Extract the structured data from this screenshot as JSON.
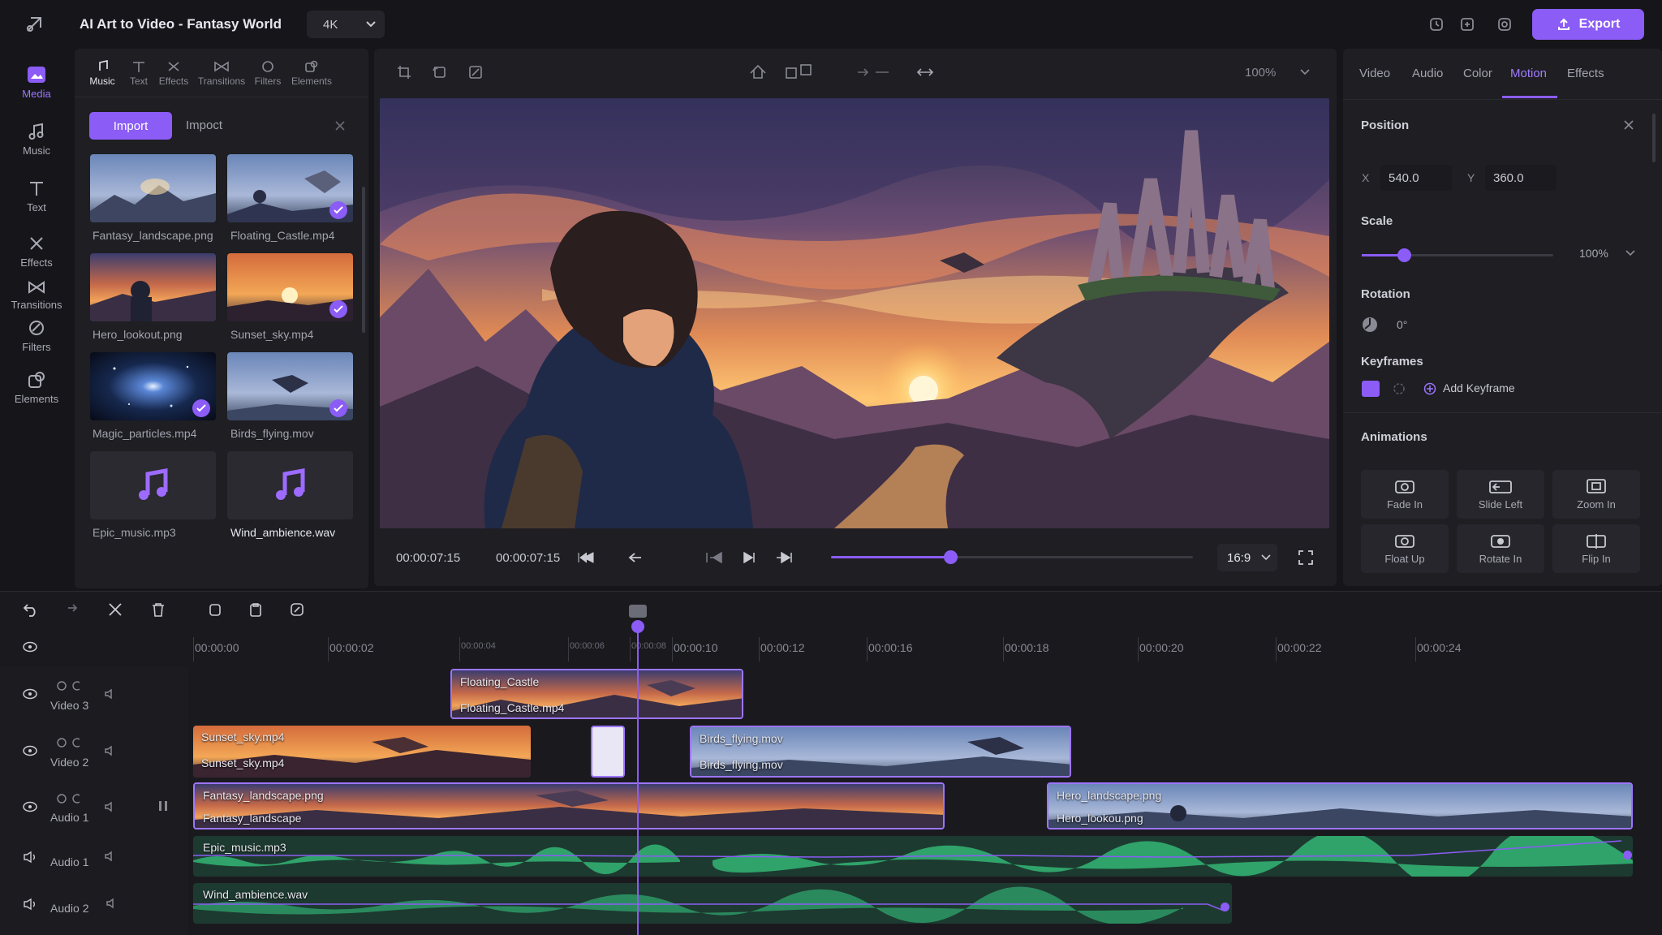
{
  "app": {
    "title": "AI Art to Video - Fantasy World",
    "resolution": "4K",
    "export_label": "Export",
    "accent": "#8b5cf6"
  },
  "rail": [
    {
      "label": "Media",
      "icon": "media-icon",
      "active": true
    },
    {
      "label": "Music",
      "icon": "music-icon"
    },
    {
      "label": "Text",
      "icon": "text-icon"
    },
    {
      "label": "Effects",
      "icon": "effects-icon"
    },
    {
      "label": "Transitions",
      "icon": "transitions-icon"
    },
    {
      "label": "Filters",
      "icon": "filters-icon"
    },
    {
      "label": "Elements",
      "icon": "elements-icon"
    }
  ],
  "media_panel": {
    "tabs": [
      "Music",
      "Text",
      "Effects",
      "Transitions",
      "Filters",
      "Elements"
    ],
    "import_label": "Import",
    "import_alt": "Impoct",
    "items": [
      {
        "name": "Fantasy_landscape.png",
        "checked": false
      },
      {
        "name": "Floating_Castle.mp4",
        "checked": true
      },
      {
        "name": "Hero_lookout.png",
        "checked": false
      },
      {
        "name": "Sunset_sky.mp4",
        "checked": true
      },
      {
        "name": "Magic_particles.mp4",
        "checked": true
      },
      {
        "name": "Birds_flying.mov",
        "checked": true
      },
      {
        "name": "Epic_music.mp3",
        "checked": false
      },
      {
        "name": "Wind_ambience.wav",
        "checked": false
      }
    ]
  },
  "preview": {
    "zoom": "100%",
    "current_time": "00:00:07:15",
    "total_time": "00:00:07:15",
    "aspect": "16:9",
    "progress": 0.33
  },
  "inspector": {
    "tabs": [
      "Video",
      "Audio",
      "Color",
      "Motion",
      "Effects"
    ],
    "active_tab": "Motion",
    "position_label": "Position",
    "x_label": "X",
    "x_value": "540.0",
    "y_label": "Y",
    "y_value": "360.0",
    "scale_label": "Scale",
    "scale_value": "100%",
    "scale_fraction": 0.22,
    "rotation_label": "Rotation",
    "rotation_value": "0°",
    "keyframes_label": "Keyframes",
    "add_keyframe": "Add Keyframe",
    "animations_label": "Animations",
    "animations": [
      "Fade In",
      "Slide Left",
      "Zoom In",
      "Float Up",
      "Rotate In",
      "Flip In"
    ]
  },
  "timeline": {
    "ticks": [
      "00:00:00",
      "00:00:02",
      "00:00:04",
      "00:00:06",
      "00:00:08",
      "00:00:10",
      "00:00:12",
      "00:00:16",
      "00:00:18",
      "00:00:20",
      "00:00:22",
      "00:00:24"
    ],
    "tracks": [
      {
        "label": "Video 3"
      },
      {
        "label": "Video 2"
      },
      {
        "label": "Audio 1"
      },
      {
        "label": "Audio 1"
      },
      {
        "label": "Audio 2"
      }
    ],
    "clips": {
      "floating_title": "Floating_Castle",
      "floating_name": "Floating_Castle.mp4",
      "sunset_title": "Sunset_sky.mp4",
      "sunset_name": "Sunset_sky.mp4",
      "birds_title": "Birds_flying.mov",
      "birds_name": "Birds_flying.mov",
      "fantasy_title": "Fantasy_landscape.png",
      "fantasy_name": "Fantasy_landscape",
      "hero_title": "Hero_landscape.png",
      "hero_name": "Hero_lookou.png",
      "epic_name": "Epic_music.mp3",
      "wind_name": "Wind_ambience.wav"
    }
  }
}
